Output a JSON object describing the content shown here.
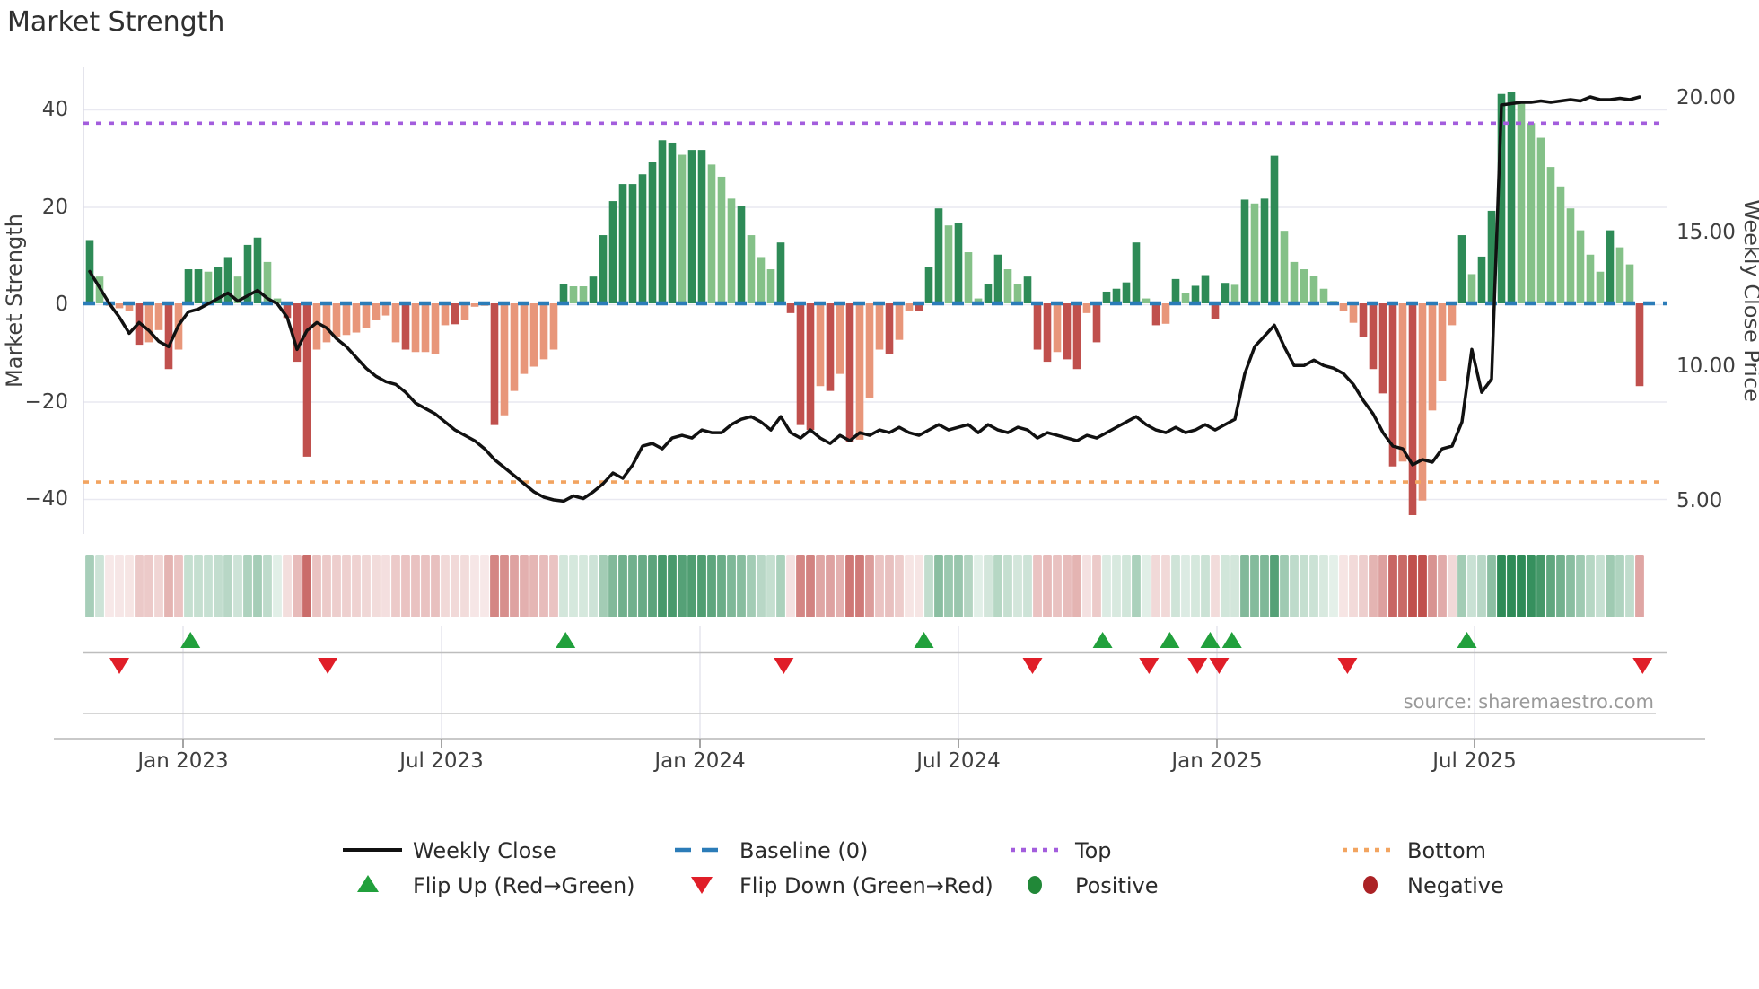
{
  "title": "Market Strength",
  "source": "source: sharemaestro.com",
  "axes": {
    "left_label": "Market Strength",
    "right_label": "Weekly Close Price",
    "left_ticks": [
      "40",
      "20",
      "0",
      "−20",
      "−40"
    ],
    "left_tick_values": [
      40,
      20,
      0,
      -20,
      -40
    ],
    "right_ticks": [
      "20.00",
      "15.00",
      "10.00",
      "5.00"
    ],
    "right_tick_values": [
      20,
      15,
      10,
      5
    ],
    "x_ticks": [
      "Jan 2023",
      "Jul 2023",
      "Jan 2024",
      "Jul 2024",
      "Jan 2025",
      "Jul 2025"
    ]
  },
  "legend": {
    "weekly_close": "Weekly Close",
    "baseline": "Baseline (0)",
    "top": "Top",
    "bottom": "Bottom",
    "flip_up": "Flip Up (Red→Green)",
    "flip_down": "Flip Down (Green→Red)",
    "positive": "Positive",
    "negative": "Negative"
  },
  "colors": {
    "bar_dark_green": "#2e8b57",
    "bar_light_green": "#84c188",
    "bar_dark_red": "#c0504d",
    "bar_light_red": "#e8967a",
    "price_line": "#111111",
    "baseline_blue": "#2b7cb8",
    "top_purple": "#a35ddd",
    "bottom_orange": "#f2a460",
    "flip_up_green": "#21a03c",
    "flip_down_red": "#e01e28",
    "positive_dot": "#218838",
    "negative_dot": "#ab2225",
    "grid": "#e9e9f1",
    "panel_border": "#c9c9c9",
    "marker_rail": "#bdbdbd"
  },
  "chart_data": {
    "type": "bar+line",
    "x_unit": "weeks (one bar per week, Oct 2022 → Nov 2025)",
    "title": "Market Strength",
    "ylabel_left": "Market Strength",
    "ylabel_right": "Weekly Close Price",
    "ylim_left": [
      -48,
      48
    ],
    "ylim_right": [
      4.3,
      21.2
    ],
    "baseline": 0,
    "top_line": 37,
    "bottom_line": -36.7,
    "x_tick_weeks": [
      9.5,
      35.6,
      61.8,
      88.0,
      114.2,
      140.3
    ],
    "bars": [
      [
        13,
        "d"
      ],
      [
        5.5,
        "l"
      ],
      [
        -0.5,
        "l"
      ],
      [
        -1,
        "l"
      ],
      [
        -1.5,
        "l"
      ],
      [
        -8.5,
        "d"
      ],
      [
        -8,
        "l"
      ],
      [
        -5.5,
        "l"
      ],
      [
        -13.5,
        "d"
      ],
      [
        -9.5,
        "l"
      ],
      [
        7,
        "d"
      ],
      [
        7,
        "d"
      ],
      [
        6.5,
        "l"
      ],
      [
        7.5,
        "d"
      ],
      [
        9.5,
        "d"
      ],
      [
        5.5,
        "l"
      ],
      [
        12,
        "d"
      ],
      [
        13.5,
        "d"
      ],
      [
        8.5,
        "l"
      ],
      [
        1,
        "l"
      ],
      [
        -3,
        "d"
      ],
      [
        -12,
        "d"
      ],
      [
        -31.5,
        "d"
      ],
      [
        -9.5,
        "l"
      ],
      [
        -8,
        "l"
      ],
      [
        -7,
        "l"
      ],
      [
        -6.5,
        "l"
      ],
      [
        -6,
        "l"
      ],
      [
        -5,
        "l"
      ],
      [
        -3.5,
        "l"
      ],
      [
        -2.5,
        "l"
      ],
      [
        -8,
        "l"
      ],
      [
        -9.5,
        "d"
      ],
      [
        -10,
        "l"
      ],
      [
        -10,
        "l"
      ],
      [
        -10.5,
        "l"
      ],
      [
        -4.5,
        "l"
      ],
      [
        -4.3,
        "d"
      ],
      [
        -3.5,
        "l"
      ],
      [
        -0.7,
        "l"
      ],
      [
        -0.5,
        "l"
      ],
      [
        -25,
        "d"
      ],
      [
        -23,
        "l"
      ],
      [
        -18,
        "l"
      ],
      [
        -14.5,
        "l"
      ],
      [
        -13,
        "l"
      ],
      [
        -11.5,
        "l"
      ],
      [
        -9.5,
        "l"
      ],
      [
        4,
        "d"
      ],
      [
        3.5,
        "l"
      ],
      [
        3.5,
        "l"
      ],
      [
        5.5,
        "d"
      ],
      [
        14,
        "d"
      ],
      [
        21,
        "d"
      ],
      [
        24.5,
        "d"
      ],
      [
        24.5,
        "d"
      ],
      [
        26.5,
        "d"
      ],
      [
        29,
        "d"
      ],
      [
        33.5,
        "d"
      ],
      [
        33,
        "d"
      ],
      [
        30.5,
        "l"
      ],
      [
        31.5,
        "d"
      ],
      [
        31.5,
        "d"
      ],
      [
        28.5,
        "l"
      ],
      [
        26,
        "l"
      ],
      [
        21.5,
        "l"
      ],
      [
        20,
        "d"
      ],
      [
        14,
        "l"
      ],
      [
        9.5,
        "l"
      ],
      [
        7,
        "l"
      ],
      [
        12.5,
        "d"
      ],
      [
        -2,
        "d"
      ],
      [
        -25,
        "d"
      ],
      [
        -26,
        "d"
      ],
      [
        -17,
        "l"
      ],
      [
        -18,
        "d"
      ],
      [
        -14.5,
        "l"
      ],
      [
        -28.5,
        "d"
      ],
      [
        -28,
        "l"
      ],
      [
        -19.5,
        "l"
      ],
      [
        -9.5,
        "l"
      ],
      [
        -10.5,
        "d"
      ],
      [
        -7.5,
        "l"
      ],
      [
        -1.5,
        "l"
      ],
      [
        -1.5,
        "d"
      ],
      [
        7.5,
        "d"
      ],
      [
        19.5,
        "d"
      ],
      [
        16,
        "l"
      ],
      [
        16.5,
        "d"
      ],
      [
        10.5,
        "l"
      ],
      [
        1,
        "l"
      ],
      [
        4,
        "d"
      ],
      [
        10,
        "d"
      ],
      [
        7,
        "l"
      ],
      [
        4,
        "l"
      ],
      [
        5.5,
        "d"
      ],
      [
        -9.5,
        "d"
      ],
      [
        -12,
        "d"
      ],
      [
        -10,
        "l"
      ],
      [
        -11.5,
        "d"
      ],
      [
        -13.5,
        "d"
      ],
      [
        -2,
        "l"
      ],
      [
        -8,
        "d"
      ],
      [
        2.4,
        "d"
      ],
      [
        3,
        "d"
      ],
      [
        4.3,
        "d"
      ],
      [
        12.5,
        "d"
      ],
      [
        1,
        "l"
      ],
      [
        -4.5,
        "d"
      ],
      [
        -4.2,
        "l"
      ],
      [
        5,
        "d"
      ],
      [
        2.2,
        "l"
      ],
      [
        3.6,
        "d"
      ],
      [
        5.8,
        "d"
      ],
      [
        -3.3,
        "d"
      ],
      [
        4.2,
        "d"
      ],
      [
        3.8,
        "l"
      ],
      [
        21.3,
        "d"
      ],
      [
        20.5,
        "l"
      ],
      [
        21.5,
        "d"
      ],
      [
        30.3,
        "d"
      ],
      [
        14.9,
        "l"
      ],
      [
        8.5,
        "l"
      ],
      [
        7,
        "l"
      ],
      [
        5.6,
        "l"
      ],
      [
        3,
        "l"
      ],
      [
        0.5,
        "l"
      ],
      [
        -1.5,
        "l"
      ],
      [
        -4,
        "l"
      ],
      [
        -7,
        "d"
      ],
      [
        -13.5,
        "d"
      ],
      [
        -18.5,
        "d"
      ],
      [
        -33.5,
        "d"
      ],
      [
        -32.5,
        "l"
      ],
      [
        -43.5,
        "d"
      ],
      [
        -40.5,
        "l"
      ],
      [
        -22,
        "l"
      ],
      [
        -16,
        "l"
      ],
      [
        -4.5,
        "l"
      ],
      [
        14,
        "d"
      ],
      [
        6,
        "l"
      ],
      [
        9.6,
        "d"
      ],
      [
        19,
        "d"
      ],
      [
        43,
        "d"
      ],
      [
        43.5,
        "d"
      ],
      [
        41,
        "l"
      ],
      [
        37,
        "l"
      ],
      [
        34,
        "l"
      ],
      [
        28,
        "l"
      ],
      [
        24,
        "l"
      ],
      [
        19.5,
        "l"
      ],
      [
        15,
        "l"
      ],
      [
        10,
        "l"
      ],
      [
        6.5,
        "l"
      ],
      [
        15,
        "d"
      ],
      [
        11.5,
        "l"
      ],
      [
        8,
        "l"
      ],
      [
        -17,
        "d"
      ]
    ],
    "weekly_close": [
      13.5,
      12.9,
      12.3,
      11.8,
      11.2,
      11.6,
      11.3,
      10.9,
      10.7,
      11.5,
      12.0,
      12.1,
      12.3,
      12.5,
      12.7,
      12.4,
      12.6,
      12.8,
      12.5,
      12.3,
      11.8,
      10.6,
      11.3,
      11.6,
      11.4,
      11.0,
      10.7,
      10.3,
      9.9,
      9.6,
      9.4,
      9.3,
      9.0,
      8.6,
      8.4,
      8.2,
      7.9,
      7.6,
      7.4,
      7.2,
      6.9,
      6.5,
      6.2,
      5.9,
      5.6,
      5.3,
      5.1,
      5.0,
      4.95,
      5.15,
      5.05,
      5.3,
      5.6,
      6.0,
      5.8,
      6.3,
      7.0,
      7.1,
      6.9,
      7.3,
      7.4,
      7.3,
      7.6,
      7.5,
      7.5,
      7.8,
      8.0,
      8.1,
      7.9,
      7.6,
      8.1,
      7.5,
      7.3,
      7.6,
      7.3,
      7.1,
      7.4,
      7.2,
      7.5,
      7.4,
      7.6,
      7.5,
      7.7,
      7.5,
      7.4,
      7.6,
      7.8,
      7.6,
      7.7,
      7.8,
      7.5,
      7.8,
      7.6,
      7.5,
      7.7,
      7.6,
      7.3,
      7.5,
      7.4,
      7.3,
      7.2,
      7.4,
      7.3,
      7.5,
      7.7,
      7.9,
      8.1,
      7.8,
      7.6,
      7.5,
      7.7,
      7.5,
      7.6,
      7.8,
      7.6,
      7.8,
      8.0,
      9.7,
      10.7,
      11.1,
      11.5,
      10.7,
      10.0,
      10.0,
      10.2,
      10.0,
      9.9,
      9.7,
      9.3,
      8.7,
      8.2,
      7.5,
      7.0,
      6.9,
      6.3,
      6.5,
      6.4,
      6.9,
      7.0,
      7.9,
      10.6,
      9.0,
      9.5,
      19.7,
      19.75,
      19.8,
      19.8,
      19.85,
      19.8,
      19.85,
      19.9,
      19.85,
      20.0,
      19.9,
      19.9,
      19.95,
      19.9,
      20.0
    ],
    "flip_up_weeks": [
      10.2,
      48.2,
      84.5,
      102.6,
      109.4,
      113.5,
      115.7,
      139.5
    ],
    "flip_down_weeks": [
      3.0,
      24.1,
      70.3,
      95.5,
      107.3,
      112.2,
      114.4,
      127.4,
      157.3
    ]
  }
}
